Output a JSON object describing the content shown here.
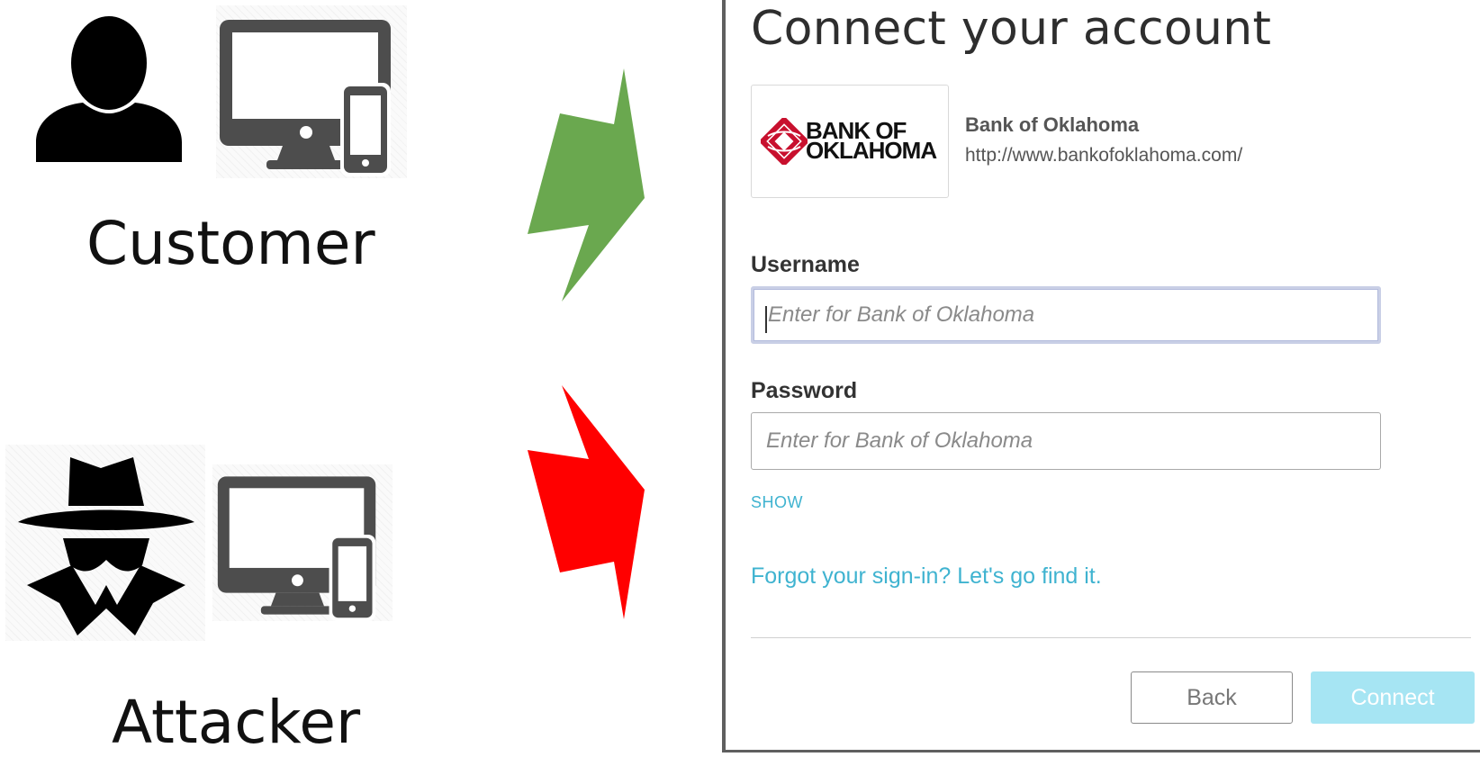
{
  "roles": {
    "customer_label": "Customer",
    "attacker_label": "Attacker"
  },
  "icons": {
    "person": "person-icon",
    "spy": "spy-icon",
    "devices": "devices-icon",
    "arrow_green": "green-arrow-icon",
    "arrow_red": "red-arrow-icon"
  },
  "colors": {
    "green_arrow": "#6aa84f",
    "red_arrow": "#ff0000",
    "link": "#3fb3d0",
    "connect_button": "#a6e5f3",
    "bank_logo_red": "#c8102e"
  },
  "dialog": {
    "title": "Connect your account",
    "bank": {
      "logo_line1": "BANK OF",
      "logo_line2": "OKLAHOMA",
      "name": "Bank of Oklahoma",
      "url": "http://www.bankofoklahoma.com/"
    },
    "username": {
      "label": "Username",
      "value": "",
      "placeholder": "Enter for Bank of Oklahoma"
    },
    "password": {
      "label": "Password",
      "value": "",
      "placeholder": "Enter for Bank of Oklahoma"
    },
    "show_label": "SHOW",
    "forgot_label": "Forgot your sign-in? Let's go find it.",
    "back_label": "Back",
    "connect_label": "Connect"
  }
}
